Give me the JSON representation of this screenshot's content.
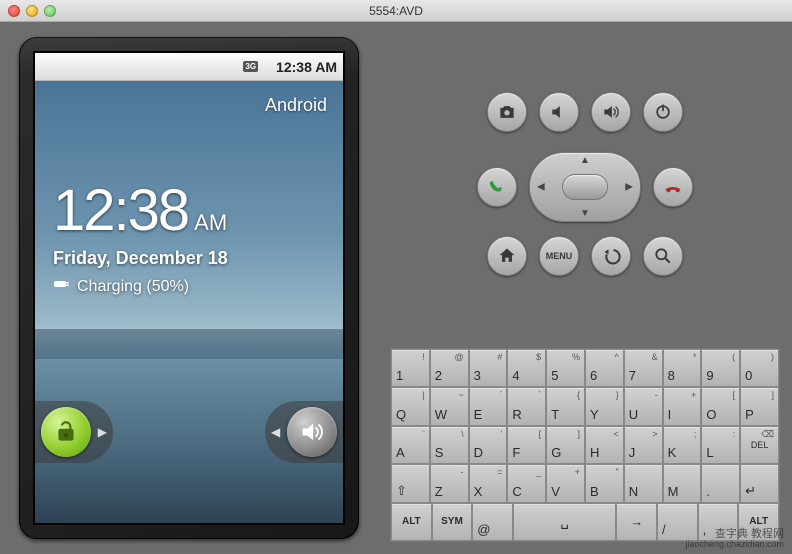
{
  "window": {
    "title": "5554:AVD"
  },
  "statusbar": {
    "time": "12:38 AM",
    "network_label": "3G"
  },
  "lockscreen": {
    "brand": "Android",
    "time": "12:38",
    "ampm": "AM",
    "date": "Friday, December 18",
    "charging": "Charging (50%)"
  },
  "hw": {
    "menu_label": "MENU",
    "call_color": "#2e9a3a",
    "end_color": "#b12a2a"
  },
  "keyboard": {
    "r1": [
      {
        "m": "1",
        "s": "!"
      },
      {
        "m": "2",
        "s": "@"
      },
      {
        "m": "3",
        "s": "#"
      },
      {
        "m": "4",
        "s": "$"
      },
      {
        "m": "5",
        "s": "%"
      },
      {
        "m": "6",
        "s": "^"
      },
      {
        "m": "7",
        "s": "&"
      },
      {
        "m": "8",
        "s": "*"
      },
      {
        "m": "9",
        "s": "("
      },
      {
        "m": "0",
        "s": ")"
      }
    ],
    "r2": [
      {
        "m": "Q",
        "s": "|"
      },
      {
        "m": "W",
        "s": "~"
      },
      {
        "m": "E",
        "s": "´"
      },
      {
        "m": "R",
        "s": "`"
      },
      {
        "m": "T",
        "s": "{"
      },
      {
        "m": "Y",
        "s": "}"
      },
      {
        "m": "U",
        "s": "-"
      },
      {
        "m": "I",
        "s": "+"
      },
      {
        "m": "O",
        "s": "["
      },
      {
        "m": "P",
        "s": "]"
      }
    ],
    "r3": [
      {
        "m": "A",
        "s": "¨"
      },
      {
        "m": "S",
        "s": "\\"
      },
      {
        "m": "D",
        "s": "'"
      },
      {
        "m": "F",
        "s": "["
      },
      {
        "m": "G",
        "s": "]"
      },
      {
        "m": "H",
        "s": "<"
      },
      {
        "m": "J",
        "s": ">"
      },
      {
        "m": "K",
        "s": ";"
      },
      {
        "m": "L",
        "s": ":"
      },
      {
        "m": "DEL",
        "s": "⌫"
      }
    ],
    "r4": [
      {
        "m": "⇧",
        "s": ""
      },
      {
        "m": "Z",
        "s": "-"
      },
      {
        "m": "X",
        "s": "="
      },
      {
        "m": "C",
        "s": "_"
      },
      {
        "m": "V",
        "s": "+"
      },
      {
        "m": "B",
        "s": "\""
      },
      {
        "m": "N",
        "s": ""
      },
      {
        "m": "M",
        "s": ""
      },
      {
        "m": ".",
        "s": ""
      },
      {
        "m": "↵",
        "s": ""
      }
    ],
    "r5": {
      "alt_l": "ALT",
      "sym": "SYM",
      "at": "@",
      "space": "␣",
      "slash": "/",
      "comma": ",",
      "alt_r": "ALT"
    }
  },
  "watermark": {
    "line1": "查字典 教程网",
    "line2": "jiaocheng.chazidian.com"
  }
}
